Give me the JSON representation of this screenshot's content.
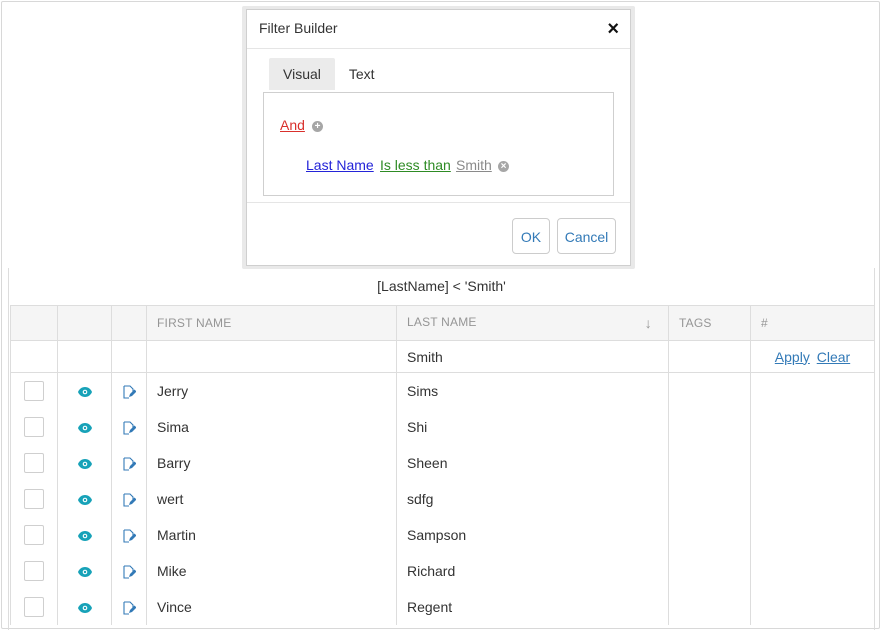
{
  "filter_expression": "[LastName] < 'Smith'",
  "dialog": {
    "title": "Filter Builder",
    "close_glyph": "×",
    "tabs": [
      {
        "label": "Visual",
        "active": true
      },
      {
        "label": "Text",
        "active": false
      }
    ],
    "group_operator": "And",
    "condition": {
      "field": "Last Name",
      "operator": "Is less than",
      "value": "Smith"
    },
    "ok_label": "OK",
    "cancel_label": "Cancel",
    "colors": {
      "group_operator": "#d9302c",
      "field": "#2424d8",
      "operator": "#2e8b24",
      "value": "#8a8a8a"
    }
  },
  "grid": {
    "columns": [
      {
        "label": ""
      },
      {
        "label": ""
      },
      {
        "label": ""
      },
      {
        "label": "FIRST NAME"
      },
      {
        "label": "LAST NAME",
        "sort": "descending"
      },
      {
        "label": "TAGS"
      },
      {
        "label": "#"
      }
    ],
    "sort_glyph": "↓",
    "filter_row": {
      "last_name": "Smith",
      "apply_label": "Apply",
      "clear_label": "Clear"
    },
    "rows": [
      {
        "first": "Jerry",
        "last": "Sims"
      },
      {
        "first": "Sima",
        "last": "Shi"
      },
      {
        "first": "Barry",
        "last": "Sheen"
      },
      {
        "first": "wert",
        "last": "sdfg"
      },
      {
        "first": "Martin",
        "last": "Sampson"
      },
      {
        "first": "Mike",
        "last": "Richard"
      },
      {
        "first": "Vince",
        "last": "Regent"
      }
    ],
    "icons": {
      "view": "eye-icon",
      "edit": "edit-icon"
    },
    "accent": "#17a2b8"
  }
}
